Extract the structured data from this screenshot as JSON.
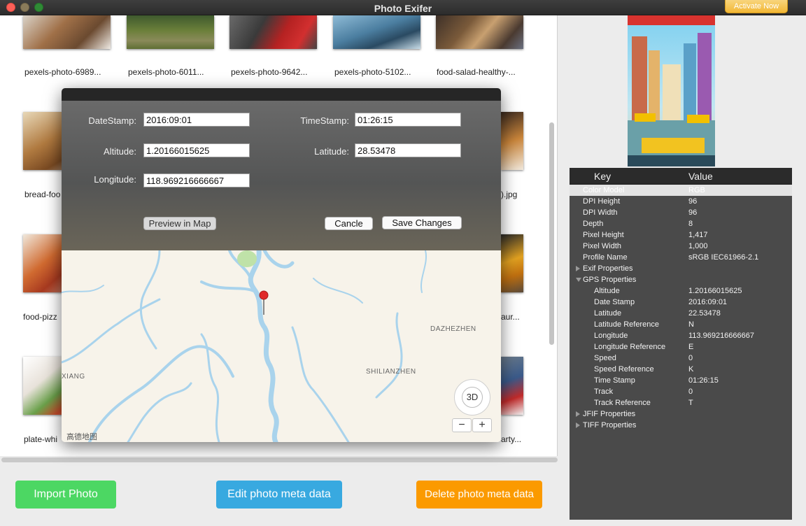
{
  "window": {
    "title": "Photo Exifer",
    "activate_label": "Activate Now"
  },
  "gallery": {
    "top_captions": [
      "pexels-photo-6989...",
      "pexels-photo-6011...",
      "pexels-photo-9642...",
      "pexels-photo-5102...",
      "food-salad-healthy-..."
    ],
    "left_captions": [
      "bread-foo",
      "food-pizz",
      "plate-whi"
    ],
    "right_captions": [
      ").jpg",
      "aur...",
      "arty..."
    ]
  },
  "dialog": {
    "labels": {
      "datestamp": "DateStamp:",
      "timestamp": "TimeStamp:",
      "altitude": "Altitude:",
      "latitude": "Latitude:",
      "longitude": "Longitude:"
    },
    "values": {
      "datestamp": "2016:09:01",
      "timestamp": "01:26:15",
      "altitude": "1.20166015625",
      "latitude": "28.53478",
      "longitude": "118.969216666667"
    },
    "preview_label": "Preview in Map",
    "cancel_label": "Cancle",
    "save_label": "Save Changes"
  },
  "map": {
    "label_dazhezhen": "DAZHEZHEN",
    "label_shilianzhen": "SHILIANZHEN",
    "label_xiang": "XIANG",
    "compass_label": "3D",
    "zoom_out": "−",
    "zoom_in": "+",
    "attribution": "高德地图"
  },
  "actions": {
    "import": "Import Photo",
    "edit": "Edit photo meta data",
    "delete": "Delete photo meta data"
  },
  "metadata": {
    "key_header": "Key",
    "value_header": "Value",
    "rows": [
      {
        "key": "Color Model",
        "value": "RGB",
        "level": 1,
        "selected": true
      },
      {
        "key": "DPI Height",
        "value": "96",
        "level": 1
      },
      {
        "key": "DPI Width",
        "value": "96",
        "level": 1
      },
      {
        "key": "Depth",
        "value": "8",
        "level": 1
      },
      {
        "key": "Pixel Height",
        "value": "1,417",
        "level": 1
      },
      {
        "key": "Pixel Width",
        "value": "1,000",
        "level": 1
      },
      {
        "key": "Profile Name",
        "value": "sRGB IEC61966-2.1",
        "level": 1
      },
      {
        "key": "Exif Properties",
        "value": "",
        "level": 1,
        "group": "collapsed"
      },
      {
        "key": "GPS Properties",
        "value": "",
        "level": 1,
        "group": "expanded"
      },
      {
        "key": "Altitude",
        "value": "1.20166015625",
        "level": 2
      },
      {
        "key": "Date Stamp",
        "value": "2016:09:01",
        "level": 2
      },
      {
        "key": "Latitude",
        "value": "22.53478",
        "level": 2
      },
      {
        "key": "Latitude Reference",
        "value": "N",
        "level": 2
      },
      {
        "key": "Longitude",
        "value": "113.969216666667",
        "level": 2
      },
      {
        "key": "Longitude Reference",
        "value": "E",
        "level": 2
      },
      {
        "key": "Speed",
        "value": "0",
        "level": 2
      },
      {
        "key": "Speed Reference",
        "value": "K",
        "level": 2
      },
      {
        "key": "Time Stamp",
        "value": "01:26:15",
        "level": 2
      },
      {
        "key": "Track",
        "value": "0",
        "level": 2
      },
      {
        "key": "Track Reference",
        "value": "T",
        "level": 2
      },
      {
        "key": "JFIF Properties",
        "value": "",
        "level": 1,
        "group": "collapsed"
      },
      {
        "key": "TIFF Properties",
        "value": "",
        "level": 1,
        "group": "collapsed"
      }
    ]
  },
  "colors": {
    "import": "#4cd763",
    "edit": "#38a9e0",
    "delete": "#fb9a00",
    "activate": "#f2b735",
    "map_water": "#a9d3ec"
  }
}
